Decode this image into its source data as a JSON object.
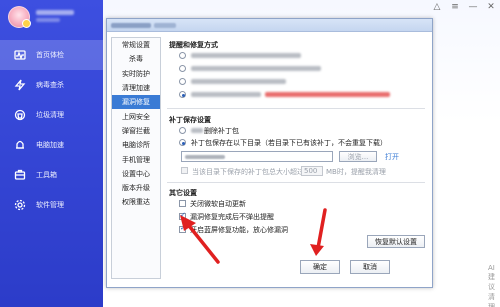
{
  "sidebar": {
    "items": [
      {
        "label": "首页体检",
        "icon": "pulse-icon"
      },
      {
        "label": "病毒查杀",
        "icon": "lightning-icon"
      },
      {
        "label": "垃圾清理",
        "icon": "trash-icon"
      },
      {
        "label": "电脑加速",
        "icon": "bell-icon"
      },
      {
        "label": "工具箱",
        "icon": "toolbox-icon"
      },
      {
        "label": "软件管理",
        "icon": "gear-icon"
      }
    ]
  },
  "window": {
    "controls": [
      "shirt-icon",
      "menu-icon",
      "minimize-icon",
      "close-icon"
    ]
  },
  "dialog": {
    "categories": [
      "常规设置",
      "杀毒",
      "实时防护",
      "清理加速",
      "漏洞修复",
      "上网安全",
      "弹窗拦截",
      "电脑诊所",
      "手机管理",
      "设置中心",
      "版本升级",
      "权限重达"
    ],
    "active_category": "漏洞修复",
    "section1_title": "提醒和修复方式",
    "section2_title": "补丁保存设置",
    "patch_option1": "删除补丁包",
    "patch_option2": "补丁包保存在以下目录（若目录下已有该补丁，不会重复下载）",
    "browse_label": "浏览...",
    "open_label": "打开",
    "size_label": "当该目录下保存的补丁包总大小超过",
    "size_value": "500",
    "size_unit": "MB时，提醒我清理",
    "section3_title": "其它设置",
    "other_options": [
      {
        "label": "关闭微软自动更新",
        "checked": false
      },
      {
        "label": "漏洞修复完成后不弹出提醒",
        "checked": true
      },
      {
        "label": "开启蓝屏修复功能，放心修漏洞",
        "checked": true
      }
    ],
    "restore_label": "恢复默认设置",
    "ok_label": "确定",
    "cancel_label": "取消"
  },
  "main": {
    "status_text": "AI建议清理"
  },
  "colors": {
    "sidebar": "#3d4fe0",
    "accent": "#3a7bd5",
    "arrow": "#e02020"
  }
}
